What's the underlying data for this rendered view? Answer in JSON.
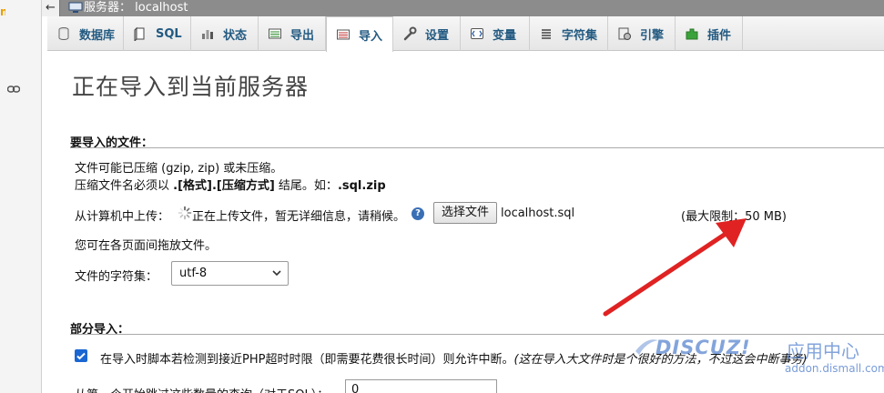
{
  "server_bar": {
    "back_glyph": "←",
    "title": "服务器： localhost",
    "icon": "server-icon"
  },
  "tabs": [
    {
      "label": "数据库",
      "icon": "database-icon"
    },
    {
      "label": "SQL",
      "icon": "sql-icon"
    },
    {
      "label": "状态",
      "icon": "status-icon"
    },
    {
      "label": "导出",
      "icon": "export-icon"
    },
    {
      "label": "导入",
      "icon": "import-icon",
      "active": true
    },
    {
      "label": "设置",
      "icon": "wrench-icon"
    },
    {
      "label": "变量",
      "icon": "variables-icon"
    },
    {
      "label": "字符集",
      "icon": "charset-icon"
    },
    {
      "label": "引擎",
      "icon": "engine-icon"
    },
    {
      "label": "插件",
      "icon": "plugin-icon"
    }
  ],
  "page_title": "正在导入到当前服务器",
  "file_section": {
    "heading": "要导入的文件：",
    "line1": "文件可能已压缩 (gzip, zip) 或未压缩。",
    "line2_prefix": "压缩文件名必须以 ",
    "line2_bold": ".[格式].[压缩方式]",
    "line2_mid": " 结尾。如：",
    "line2_example": ".sql.zip",
    "upload_label": "从计算机中上传：",
    "upload_status": "正在上传文件，暂无详细信息，请稍候。",
    "choose_file_button": "选择文件",
    "file_name": "localhost.sql",
    "max_limit": "(最大限制：50 MB)",
    "drag_hint": "您可在各页面间拖放文件。",
    "charset_label": "文件的字符集：",
    "charset_value": "utf-8"
  },
  "partial_section": {
    "heading": "部分导入：",
    "allow_interrupt_text": "在导入时脚本若检测到接近PHP超时时限（即需要花费很长时间）则允许中断。",
    "allow_interrupt_note": "(这在导入大文件时是个很好的方法，不过这会中断事务)",
    "allow_interrupt_checked": true,
    "skip_label": "从第一个开始跳过这些数量的查询（对于SQL）：",
    "skip_value": "0"
  },
  "watermark": {
    "logo": "DISCUZ!",
    "cn": "应用中心",
    "url": "addon.dismall.com"
  },
  "colors": {
    "tab_text": "#235a81",
    "arrow": "#e02222",
    "checkbox": "#1a66d2",
    "server_bar": "#8c8c8c"
  }
}
